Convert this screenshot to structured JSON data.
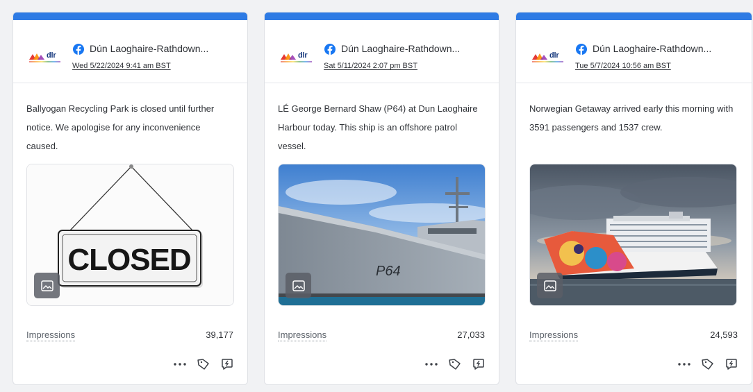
{
  "colors": {
    "accent_bar": "#2e7be4",
    "facebook": "#1877f2"
  },
  "posts": [
    {
      "network_icon": "facebook-icon",
      "account": "Dún Laoghaire-Rathdown...",
      "date": "Wed 5/22/2024 9:41 am BST",
      "text": "Ballyogan Recycling Park is closed until further notice. We apologise for any inconvenience caused.",
      "image_sign_text": "CLOSED",
      "impressions_label": "Impressions",
      "impressions_value": "39,177"
    },
    {
      "network_icon": "facebook-icon",
      "account": "Dún Laoghaire-Rathdown...",
      "date": "Sat 5/11/2024 2:07 pm BST",
      "text": "LÉ George Bernard Shaw (P64) at Dun Laoghaire Harbour today. This ship is an offshore patrol vessel.",
      "image_hull_text": "P64",
      "impressions_label": "Impressions",
      "impressions_value": "27,033"
    },
    {
      "network_icon": "facebook-icon",
      "account": "Dún Laoghaire-Rathdown...",
      "date": "Tue 5/7/2024 10:56 am BST",
      "text": "Norwegian Getaway arrived early this morning with 3591 passengers and 1537 crew.",
      "impressions_label": "Impressions",
      "impressions_value": "24,593"
    }
  ],
  "logo_text": "dlr",
  "actions": [
    "more-icon",
    "tag-icon",
    "reply-icon"
  ]
}
